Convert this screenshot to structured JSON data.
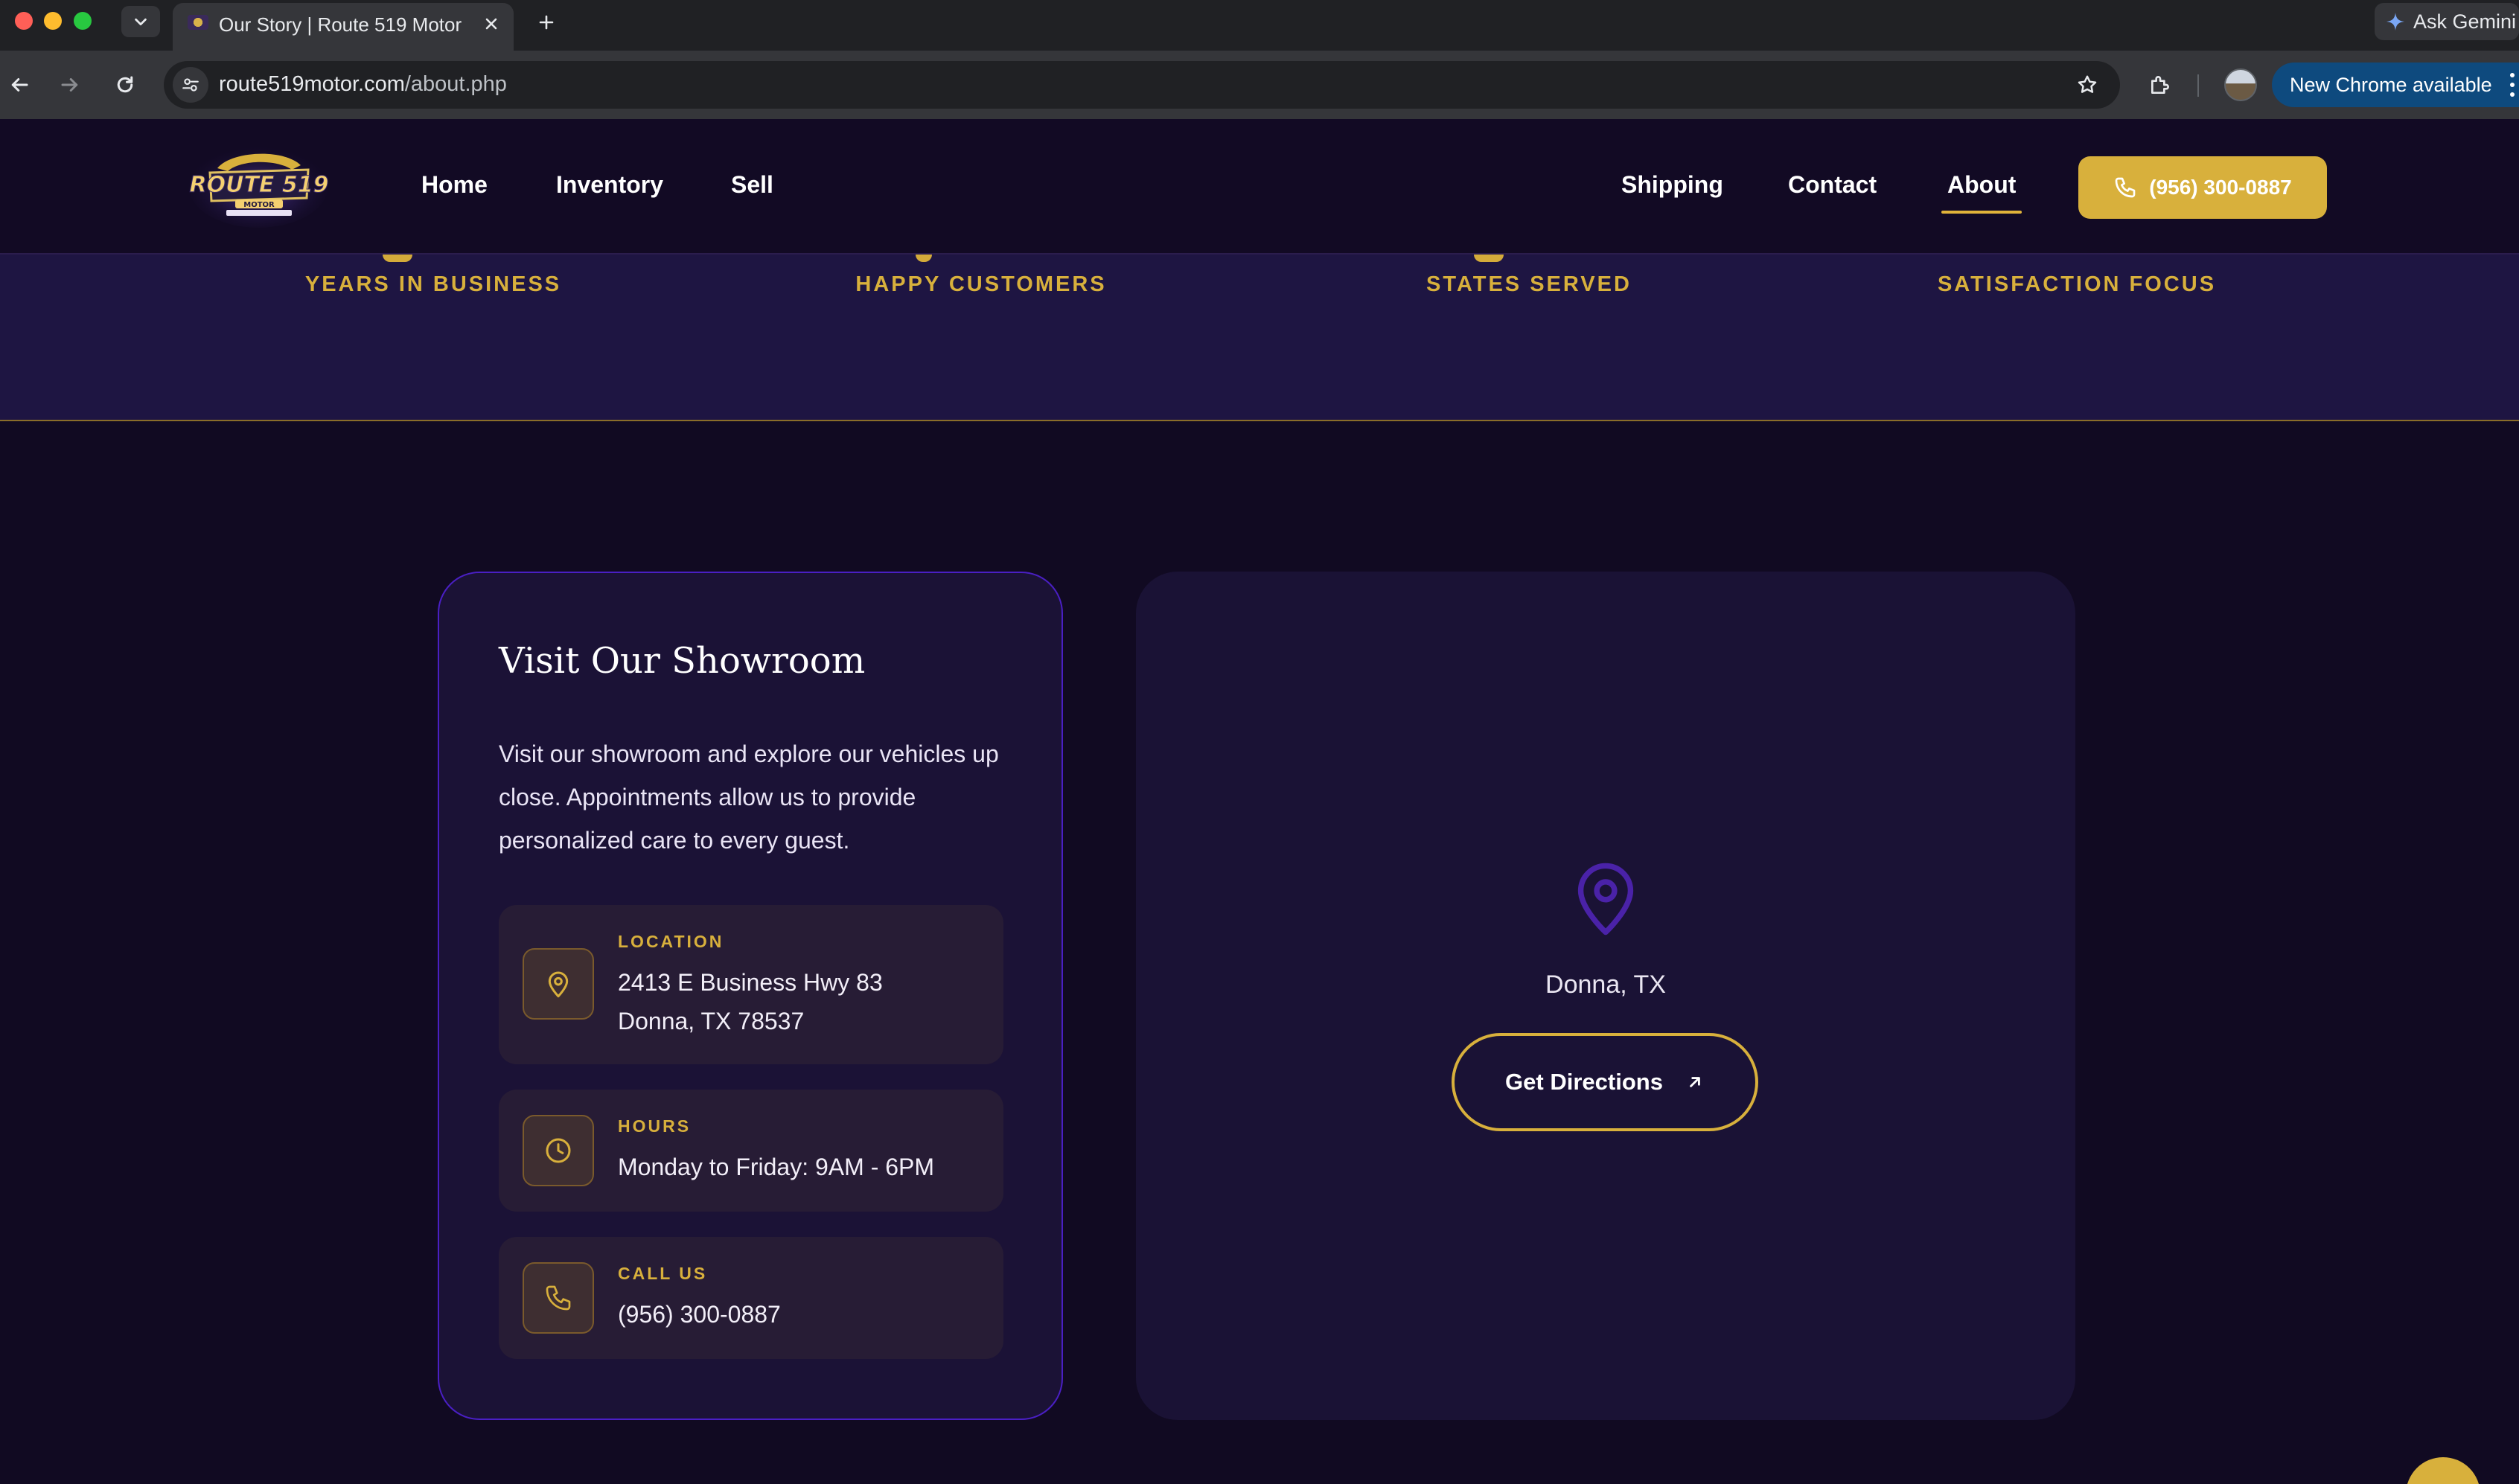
{
  "browser": {
    "tab_title": "Our Story | Route 519 Motor",
    "url_host": "route519motor.com",
    "url_path": "/about.php",
    "gemini_label": "Ask Gemini",
    "update_label": "New Chrome available"
  },
  "header": {
    "logo_alt": "Route 519 Motor — New & Used Cars",
    "nav_left": [
      "Home",
      "Inventory",
      "Sell"
    ],
    "nav_right": [
      "Shipping",
      "Contact",
      "About"
    ],
    "active_nav": "About",
    "phone_button": "(956) 300-0887"
  },
  "stats": {
    "labels": [
      "YEARS IN BUSINESS",
      "HAPPY CUSTOMERS",
      "STATES SERVED",
      "SATISFACTION FOCUS"
    ]
  },
  "showroom": {
    "title": "Visit Our Showroom",
    "description": "Visit our showroom and explore our vehicles up close. Appointments allow us to provide personalized care to every guest.",
    "location": {
      "label": "LOCATION",
      "line1": "2413 E Business Hwy 83",
      "line2": "Donna, TX 78537",
      "icon": "map-pin-icon"
    },
    "hours": {
      "label": "HOURS",
      "line1": "Monday to Friday: 9AM - 6PM",
      "icon": "clock-icon"
    },
    "call": {
      "label": "CALL US",
      "line1": "(956) 300-0887",
      "icon": "phone-icon"
    }
  },
  "map": {
    "city": "Donna, TX",
    "directions_label": "Get Directions"
  },
  "colors": {
    "page_bg": "#110a22",
    "band_bg": "#1e1542",
    "accent_gold": "#d8b03c",
    "accent_purple": "#4a1fc4"
  }
}
